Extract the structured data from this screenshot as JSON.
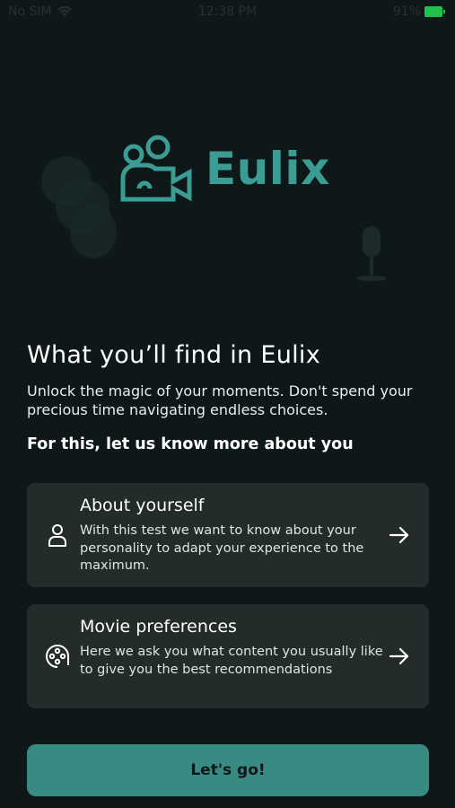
{
  "status_bar": {
    "carrier": "No SIM",
    "time": "12:38 PM",
    "battery": "91%"
  },
  "brand": {
    "name": "Eulix",
    "accent_color": "#3a9c93",
    "logo_icon": "people-camera-icon"
  },
  "intro": {
    "title": "What you’ll find in Eulix",
    "subtitle": "Unlock the magic of your moments. Don't spend your precious time navigating endless choices.",
    "prompt": "For this, let us know more about you"
  },
  "cards": [
    {
      "icon": "user-icon",
      "title": "About yourself",
      "description": "With this test we want to know about your personality to adapt your experience to the maximum."
    },
    {
      "icon": "film-reel-icon",
      "title": "Movie preferences",
      "description": "Here we ask you what content you usually like to give you the best recommendations"
    }
  ],
  "cta": {
    "label": "Let's go!",
    "color": "#3a8a84"
  }
}
